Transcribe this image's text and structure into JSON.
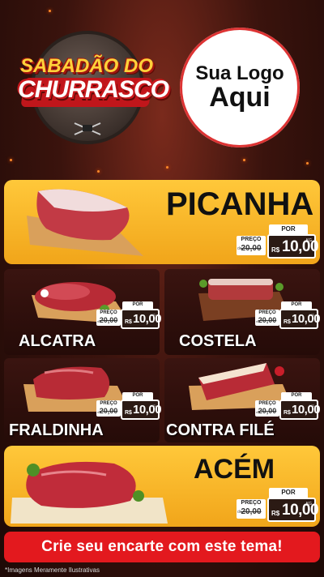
{
  "header": {
    "badge_line1": "SABADÃO DO",
    "badge_line2": "CHURRASCO",
    "brand_line1": "Sua Logo",
    "brand_line2": "Aqui"
  },
  "tag_labels": {
    "por": "POR",
    "preco": "PREÇO",
    "currency": "R$",
    "unit": "KG",
    "de": "de"
  },
  "products": [
    {
      "name": "PICANHA",
      "old_price": "20,00",
      "price": "10,00",
      "icon": "beef-cut-icon"
    },
    {
      "name": "ALCATRA",
      "old_price": "20,00",
      "price": "10,00",
      "icon": "beef-cut-icon"
    },
    {
      "name": "COSTELA",
      "old_price": "20,00",
      "price": "10,00",
      "icon": "beef-cut-icon"
    },
    {
      "name": "FRALDINHA",
      "old_price": "20,00",
      "price": "10,00",
      "icon": "beef-cut-icon"
    },
    {
      "name": "CONTRA FILÉ",
      "old_price": "20,00",
      "price": "10,00",
      "icon": "beef-cut-icon"
    },
    {
      "name": "ACÉM",
      "old_price": "20,00",
      "price": "10,00",
      "icon": "beef-cut-icon"
    }
  ],
  "cta": "Crie seu encarte com este tema!",
  "disclaimer": "*Imagens Meramente Ilustrativas",
  "colors": {
    "gold": "#f1a51a",
    "red": "#e3191e",
    "dark": "#250b08"
  }
}
